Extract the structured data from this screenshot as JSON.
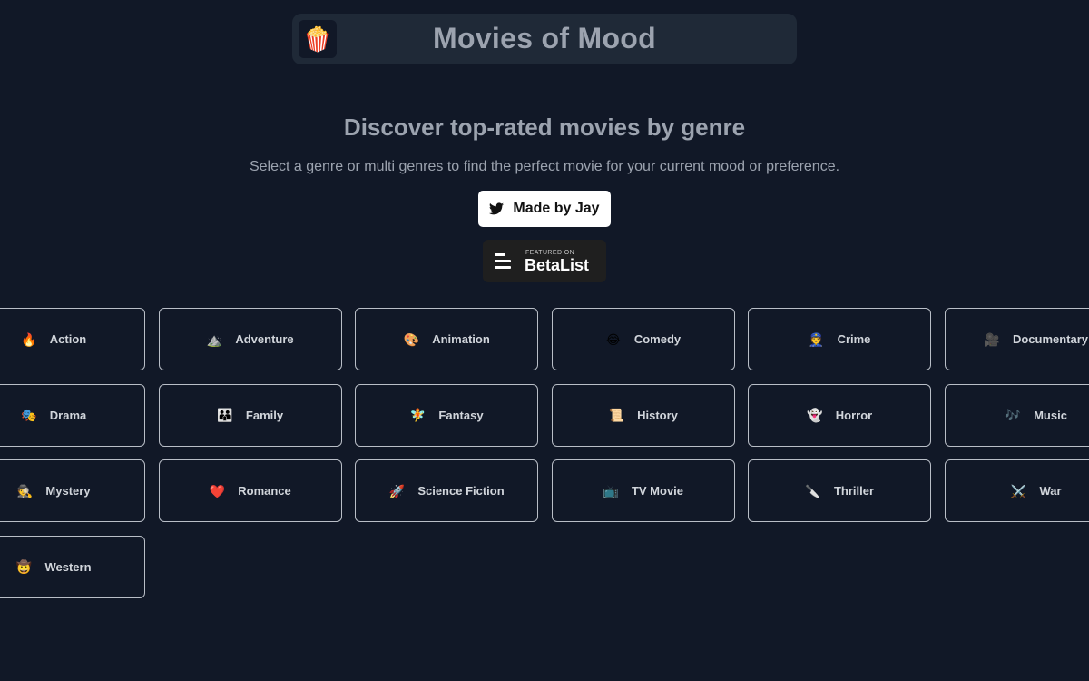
{
  "header": {
    "logo_icon": "🍿",
    "title": "Movies of Mood"
  },
  "hero": {
    "title": "Discover top-rated movies by genre",
    "subtitle": "Select a genre or multi genres to find the perfect movie for your current mood or preference."
  },
  "made_by_button": {
    "icon": "twitter-icon",
    "label": "Made by Jay"
  },
  "betalist_badge": {
    "featured_text": "FEATURED ON",
    "brand": "BetaList"
  },
  "genres": [
    {
      "emoji": "🔥",
      "label": "Action"
    },
    {
      "emoji": "⛰️",
      "label": "Adventure"
    },
    {
      "emoji": "🎨",
      "label": "Animation"
    },
    {
      "emoji": "😂",
      "label": "Comedy"
    },
    {
      "emoji": "👮",
      "label": "Crime"
    },
    {
      "emoji": "🎥",
      "label": "Documentary"
    },
    {
      "emoji": "🎭",
      "label": "Drama"
    },
    {
      "emoji": "👪",
      "label": "Family"
    },
    {
      "emoji": "🧚",
      "label": "Fantasy"
    },
    {
      "emoji": "📜",
      "label": "History"
    },
    {
      "emoji": "👻",
      "label": "Horror"
    },
    {
      "emoji": "🎶",
      "label": "Music"
    },
    {
      "emoji": "🕵️",
      "label": "Mystery"
    },
    {
      "emoji": "❤️",
      "label": "Romance"
    },
    {
      "emoji": "🚀",
      "label": "Science Fiction"
    },
    {
      "emoji": "📺",
      "label": "TV Movie"
    },
    {
      "emoji": "🔪",
      "label": "Thriller"
    },
    {
      "emoji": "⚔️",
      "label": "War"
    },
    {
      "emoji": "🤠",
      "label": "Western"
    }
  ],
  "colors": {
    "background": "#111827",
    "header_bg": "#1f2937",
    "text_muted": "#9ca3af",
    "card_border": "#b9bec7"
  }
}
